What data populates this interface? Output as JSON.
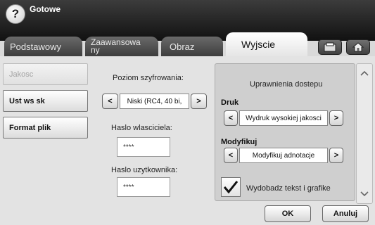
{
  "header": {
    "status": "Gotowe",
    "help_icon": "?"
  },
  "tabs": [
    {
      "label": "Podstawowy"
    },
    {
      "label": "Zaawansowa ny"
    },
    {
      "label": "Obraz"
    },
    {
      "label": "Wyjscie"
    }
  ],
  "sidebar": {
    "items": [
      {
        "label": "Jakosc",
        "state": "disabled"
      },
      {
        "label": "Ust ws sk"
      },
      {
        "label": "Format plik"
      }
    ]
  },
  "encryption": {
    "label": "Poziom szyfrowania:",
    "value": "Niski (RC4, 40 bi,",
    "prev": "<",
    "next": ">"
  },
  "owner_password": {
    "label": "Haslo wlasciciela:",
    "value": "****"
  },
  "user_password": {
    "label": "Haslo uzytkownika:",
    "value": "****"
  },
  "permissions": {
    "title": "Uprawnienia dostepu",
    "print": {
      "label": "Druk",
      "value": "Wydruk wysokiej jakosci",
      "prev": "<",
      "next": ">"
    },
    "modify": {
      "label": "Modyfikuj",
      "value": "Modyfikuj adnotacje",
      "prev": "<",
      "next": ">"
    },
    "extract": {
      "label": "Wydobadz tekst i grafike",
      "checked": true
    }
  },
  "footer": {
    "ok": "OK",
    "cancel": "Anuluj"
  },
  "colors": {
    "header_bg": "#1e1e1e",
    "tab_bg": "#4f4f4f",
    "panel_bg": "#cfcfcf"
  }
}
